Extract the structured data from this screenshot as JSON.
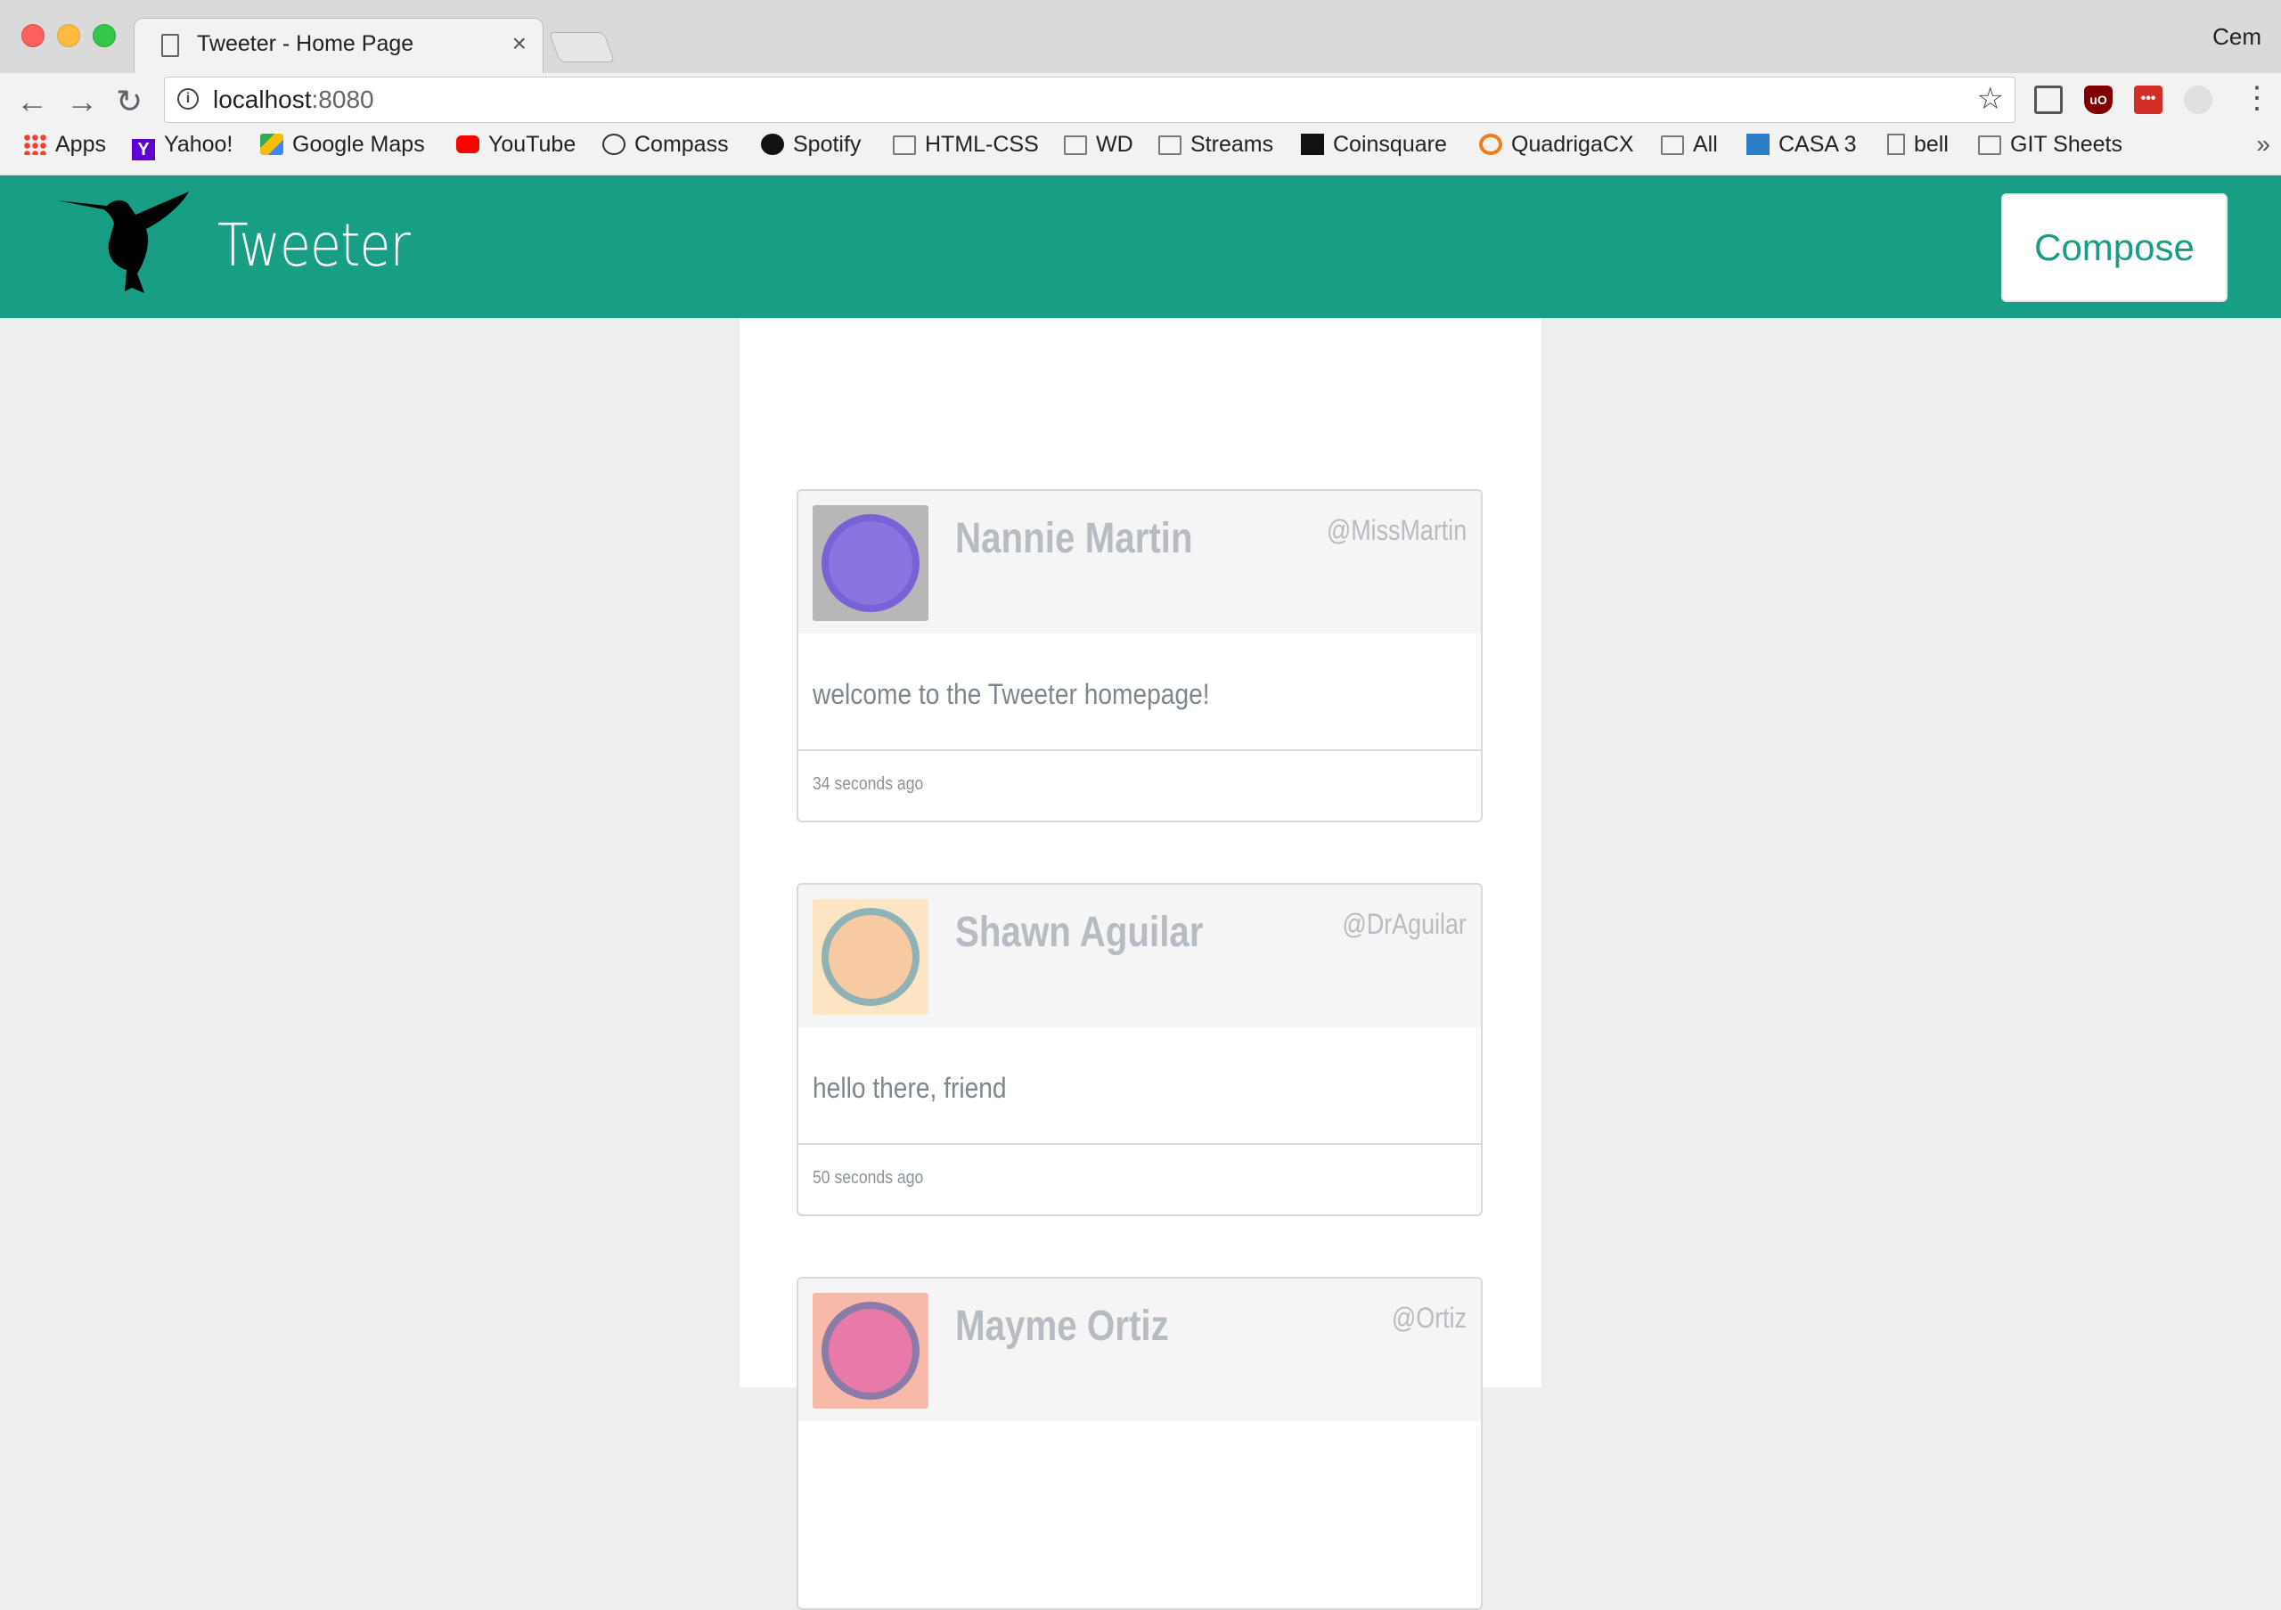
{
  "browser": {
    "tab_title": "Tweeter - Home Page",
    "tab_close": "×",
    "profile": "Cem",
    "url_host": "localhost",
    "url_port": ":8080",
    "nav": {
      "back": "←",
      "forward": "→",
      "reload": "↻"
    },
    "star": "☆",
    "menu": "⋮",
    "more_bookmarks": "»",
    "bookmarks": [
      {
        "label": "Apps",
        "icon": "apps-icon"
      },
      {
        "label": "Yahoo!",
        "icon": "yahoo-icon"
      },
      {
        "label": "Google Maps",
        "icon": "maps-icon"
      },
      {
        "label": "YouTube",
        "icon": "youtube-icon"
      },
      {
        "label": "Compass",
        "icon": "compass-icon"
      },
      {
        "label": "Spotify",
        "icon": "spotify-icon"
      },
      {
        "label": "HTML-CSS",
        "icon": "folder-icon"
      },
      {
        "label": "WD",
        "icon": "folder-icon"
      },
      {
        "label": "Streams",
        "icon": "folder-icon"
      },
      {
        "label": "Coinsquare",
        "icon": "coinsquare-icon"
      },
      {
        "label": "QuadrigaCX",
        "icon": "quadriga-icon"
      },
      {
        "label": "All",
        "icon": "folder-icon"
      },
      {
        "label": "CASA 3",
        "icon": "casa-icon"
      },
      {
        "label": "bell",
        "icon": "document-icon"
      },
      {
        "label": "GIT Sheets",
        "icon": "folder-icon"
      }
    ]
  },
  "header": {
    "brand": "Tweeter",
    "compose_label": "Compose",
    "logo_icon": "hummingbird-icon",
    "color": "#199e86"
  },
  "tweets": [
    {
      "name": "Nannie Martin",
      "handle": "@MissMartin",
      "content": "welcome to the Tweeter homepage!",
      "time": "34 seconds ago",
      "avatar_bg": "#b7b7b7",
      "avatar_face": "#8a74e0"
    },
    {
      "name": "Shawn Aguilar",
      "handle": "@DrAguilar",
      "content": "hello there, friend",
      "time": "50 seconds ago",
      "avatar_bg": "#fde4c3",
      "avatar_face": "#8fb3b4"
    },
    {
      "name": "Mayme Ortiz",
      "handle": "@Ortiz",
      "content": "",
      "time": "",
      "avatar_bg": "#f7b9a8",
      "avatar_face": "#e87aa8"
    }
  ]
}
